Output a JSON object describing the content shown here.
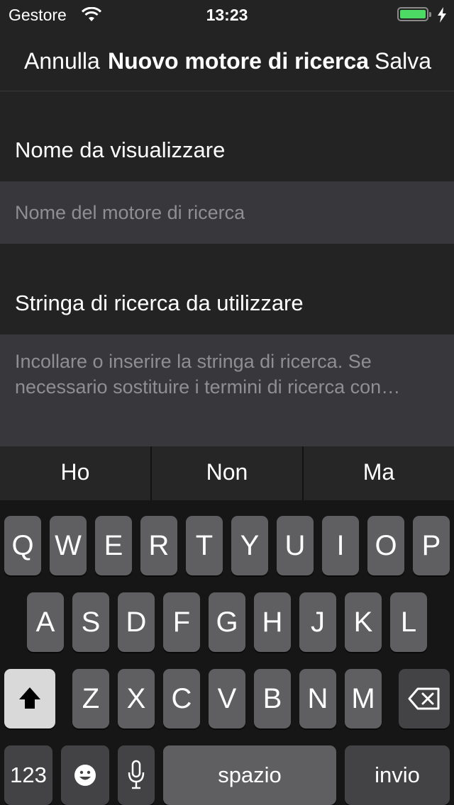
{
  "status": {
    "carrier": "Gestore",
    "time": "13:23",
    "battery_level": 1.0,
    "charging": true
  },
  "nav": {
    "cancel": "Annulla",
    "title": "Nuovo motore di ricerca",
    "save": "Salva"
  },
  "form": {
    "name_label": "Nome da visualizzare",
    "name_placeholder": "Nome del motore di ricerca",
    "string_label": "Stringa di ricerca da utilizzare",
    "string_placeholder_line1": "Incollare o inserire la stringa di ricerca. Se",
    "string_placeholder_line2": "necessario sostituire i termini di ricerca con…"
  },
  "keyboard": {
    "suggestions": [
      "Ho",
      "Non",
      "Ma"
    ],
    "row1": [
      "Q",
      "W",
      "E",
      "R",
      "T",
      "Y",
      "U",
      "I",
      "O",
      "P"
    ],
    "row2": [
      "A",
      "S",
      "D",
      "F",
      "G",
      "H",
      "J",
      "K",
      "L"
    ],
    "row3": [
      "Z",
      "X",
      "C",
      "V",
      "B",
      "N",
      "M"
    ],
    "numbers_key": "123",
    "space_key": "spazio",
    "return_key": "invio",
    "icons": {
      "shift": "shift-icon",
      "delete": "delete-icon",
      "emoji": "emoji-icon",
      "mic": "microphone-icon"
    }
  }
}
